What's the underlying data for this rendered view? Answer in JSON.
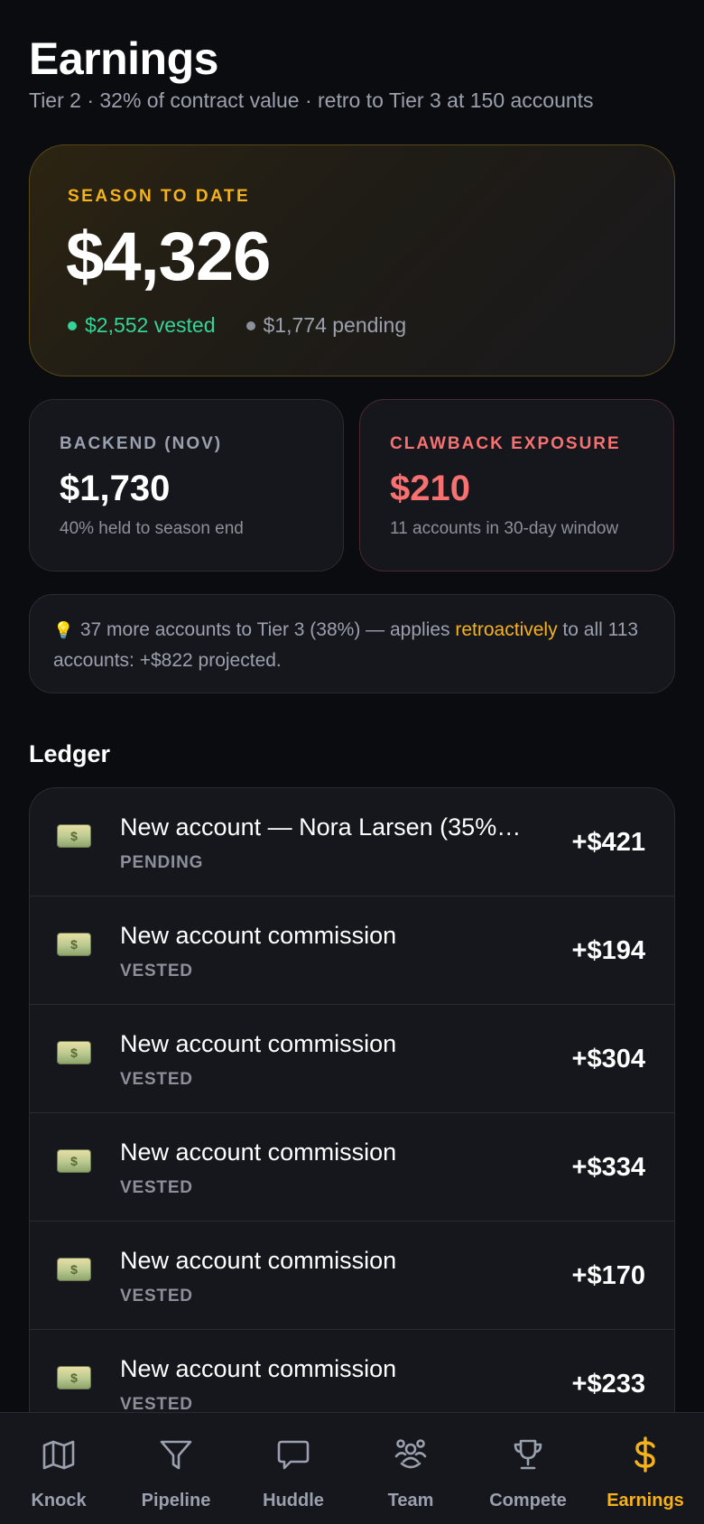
{
  "header": {
    "title": "Earnings",
    "subtitle": "Tier 2 · 32% of contract value · retro to Tier 3 at 150 accounts"
  },
  "hero": {
    "label": "SEASON TO DATE",
    "value": "$4,326",
    "vested": "$2,552 vested",
    "pending": "$1,774 pending"
  },
  "cards": {
    "backend": {
      "label": "BACKEND (NOV)",
      "value": "$1,730",
      "note": "40% held to season end"
    },
    "clawback": {
      "label": "CLAWBACK EXPOSURE",
      "value": "$210",
      "note": "11 accounts in 30-day window"
    }
  },
  "tip": {
    "icon": "💡",
    "text_before": "37 more accounts to Tier 3 (38%) — applies ",
    "highlight": "retroactively",
    "text_after": " to all 113 accounts: +$822 projected."
  },
  "ledger": {
    "title": "Ledger",
    "rows": [
      {
        "icon": "money-icon",
        "title": "New account — Nora Larsen (35%…",
        "status": "PENDING",
        "amount": "+$421"
      },
      {
        "icon": "money-icon",
        "title": "New account commission",
        "status": "VESTED",
        "amount": "+$194"
      },
      {
        "icon": "money-icon",
        "title": "New account commission",
        "status": "VESTED",
        "amount": "+$304"
      },
      {
        "icon": "money-icon",
        "title": "New account commission",
        "status": "VESTED",
        "amount": "+$334"
      },
      {
        "icon": "money-icon",
        "title": "New account commission",
        "status": "VESTED",
        "amount": "+$170"
      },
      {
        "icon": "money-icon",
        "title": "New account commission",
        "status": "VESTED",
        "amount": "+$233"
      }
    ]
  },
  "tabs": [
    {
      "label": "Knock",
      "icon": "map-icon"
    },
    {
      "label": "Pipeline",
      "icon": "funnel-icon"
    },
    {
      "label": "Huddle",
      "icon": "chat-icon"
    },
    {
      "label": "Team",
      "icon": "team-icon"
    },
    {
      "label": "Compete",
      "icon": "trophy-icon"
    },
    {
      "label": "Earnings",
      "icon": "dollar-icon",
      "active": true
    }
  ],
  "colors": {
    "accent": "#f5b21c",
    "vested": "#34d399",
    "danger": "#f87171",
    "background": "#0b0c0f",
    "card": "#16171c"
  }
}
